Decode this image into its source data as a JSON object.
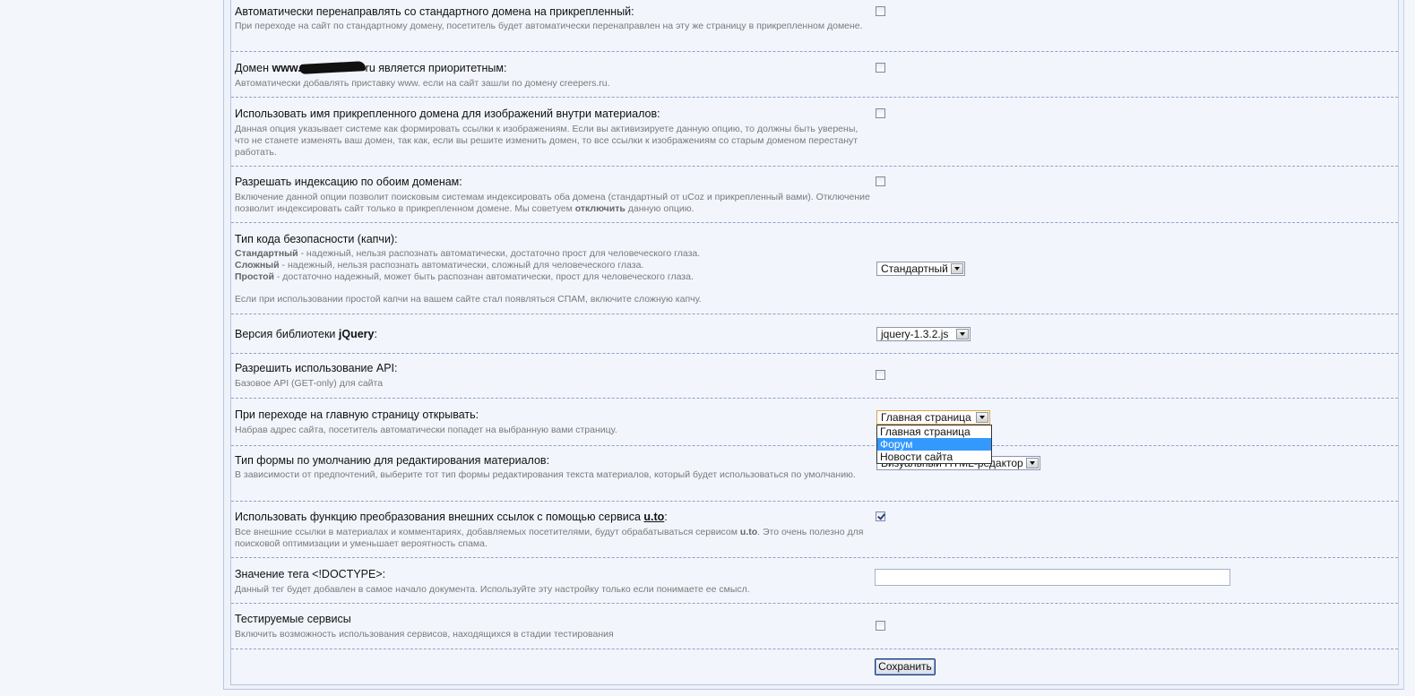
{
  "settings": [
    {
      "title": "Автоматически перенаправлять со стандартного домена на прикрепленный:",
      "desc": "При переходе на сайт по стандартному домену, посетитель будет автоматически перенаправлен на эту же страницу в прикрепленном домене.",
      "checked": false
    },
    {
      "title_prefix": "Домен ",
      "title_bold": "www.",
      "title_suffix": "ru является приоритетным:",
      "desc": "Автоматически добавлять приставку www. если на сайт зашли по домену creepers.ru.",
      "checked": false
    },
    {
      "title": "Использовать имя прикрепленного домена для изображений внутри материалов:",
      "desc": "Данная опция указывает системе как формировать ссылки к изображениям. Если вы активизируете данную опцию, то должны быть уверены, что не станете изменять ваш домен, так как, если вы решите изменить домен, то все ссылки к изображениям со старым доменом перестанут работать.",
      "checked": false
    },
    {
      "title": "Разрешать индексацию по обоим доменам:",
      "desc_prefix": "Включение данной опции позволит поисковым системам индексировать оба домена (стандартный от uCoz и прикрепленный вами). Отключение позволит индексировать сайт только в прикрепленном домене. Мы советуем ",
      "desc_bold": "отключить",
      "desc_suffix": " данную опцию.",
      "checked": false
    },
    {
      "title": "Тип кода безопасности (капчи):",
      "lines": [
        {
          "bold": "Стандартный",
          "text": " - надежный, нельзя распознать автоматически, достаточно прост для человеческого глаза."
        },
        {
          "bold": "Сложный",
          "text": " - надежный, нельзя распознать автоматически, сложный для человеческого глаза."
        },
        {
          "bold": "Простой",
          "text": " - достаточно надежный, может быть распознан автоматически, прост для человеческого глаза."
        }
      ],
      "note": "Если при использовании простой капчи на вашем сайте стал появляться СПАМ, включите сложную капчу.",
      "selected": "Стандартный"
    },
    {
      "title_prefix": "Версия библиотеки ",
      "title_bold": "jQuery",
      "title_suffix": ":",
      "selected": "jquery-1.3.2.js"
    },
    {
      "title": "Разрешить использование API:",
      "desc": "Базовое API (GET-only) для сайта",
      "checked": false
    },
    {
      "title": "При переходе на главную страницу открывать:",
      "desc": "Набрав адрес сайта, посетитель автоматически попадет на выбранную вами страницу.",
      "selected": "Главная страница",
      "options": [
        "Главная страница",
        "Форум",
        "Новости сайта"
      ],
      "highlighted": "Форум"
    },
    {
      "title": "Тип формы по умолчанию для редактирования материалов:",
      "desc": "В зависимости от предпочтений, выберите тот тип формы редактирования текста материалов, который будет использоваться по умолчанию.",
      "selected": "Визуальный HTML-редактор"
    },
    {
      "title_prefix": "Использовать функцию преобразования внешних ссылок с помощью сервиса ",
      "title_bold": "u.to",
      "title_suffix": ":",
      "desc_prefix": "Все внешние ссылки в материалах и комментариях, добавляемых посетителями, будут обрабатываться сервисом ",
      "desc_bold": "u.to",
      "desc_suffix": ". Это очень полезно для поисковой оптимизации и уменьшает вероятность спама.",
      "checked": true
    },
    {
      "title": "Значение тега <!DOCTYPE>:",
      "desc": "Данный тег будет добавлен в самое начало документа. Используйте эту настройку только если понимаете ее смысл.",
      "value": ""
    },
    {
      "title": "Тестируемые сервисы",
      "desc": "Включить возможность использования сервисов, находящихся в стадии тестирования",
      "checked": false
    }
  ],
  "save_label": "Сохранить"
}
